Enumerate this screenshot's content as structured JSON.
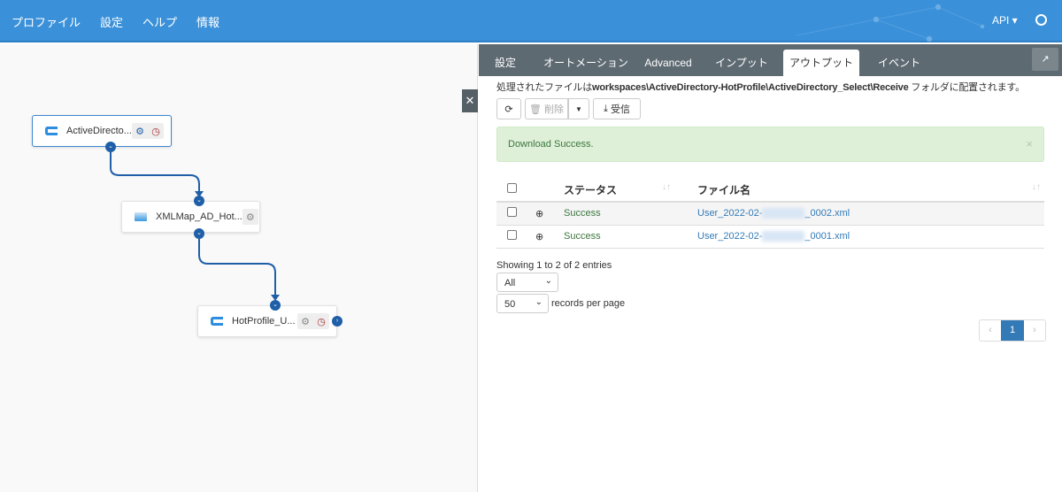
{
  "header": {
    "nav": [
      "プロファイル",
      "設定",
      "ヘルプ",
      "情報"
    ],
    "api_label": "API ▾",
    "brand_color": "#3b91d9"
  },
  "canvas": {
    "nodes": [
      {
        "label": "ActiveDirecto...",
        "icon": "connector-icon"
      },
      {
        "label": "XMLMap_AD_Hot...",
        "icon": "xmlmap-icon"
      },
      {
        "label": "HotProfile_U...",
        "icon": "connector-icon"
      }
    ]
  },
  "panel": {
    "tabs": [
      "設定",
      "オートメーション",
      "Advanced",
      "インプット",
      "アウトプット",
      "イベント"
    ],
    "active_tab": "アウトプット",
    "info_prefix": "処理されたファイルは",
    "info_path": "workspaces\\ActiveDirectory-HotProfile\\ActiveDirectory_Select\\Receive",
    "info_suffix": " フォルダに配置されます。",
    "toolbar": {
      "delete_label": "削除",
      "receive_label": "受信"
    },
    "alert": "Download Success.",
    "table": {
      "headers": [
        "ステータス",
        "ファイル名"
      ],
      "rows": [
        {
          "status": "Success",
          "file_prefix": "User_2022-02-",
          "file_suffix": "_0002.xml"
        },
        {
          "status": "Success",
          "file_prefix": "User_2022-02-",
          "file_suffix": "_0001.xml"
        }
      ]
    },
    "showing": "Showing 1 to 2 of 2 entries",
    "filter_value": "All",
    "page_size": "50",
    "records_per_page": "records per page",
    "current_page": "1"
  }
}
